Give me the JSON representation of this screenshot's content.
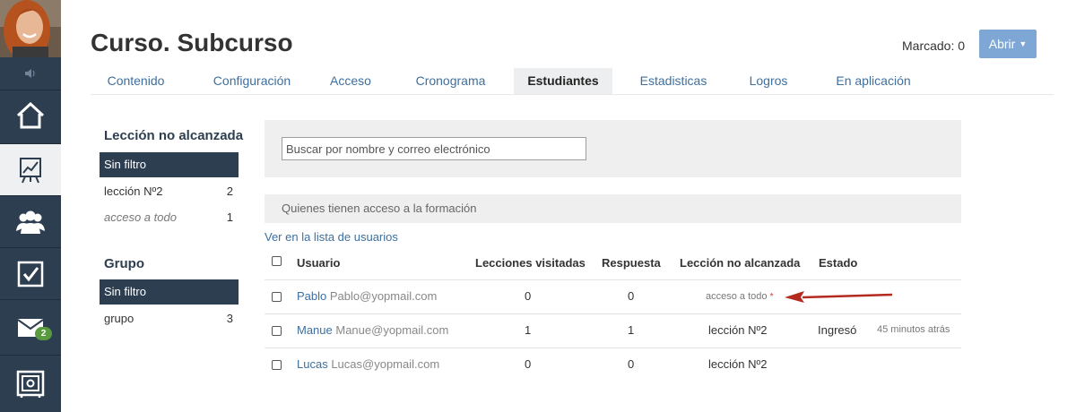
{
  "sidebar": {
    "mail_badge": "2"
  },
  "header": {
    "title": "Curso. Subcurso",
    "marcado": "Marcado: 0",
    "open_button": "Abrir"
  },
  "tabs": [
    "Contenido",
    "Configuración",
    "Acceso",
    "Cronograma",
    "Estudiantes",
    "Estadisticas",
    "Logros",
    "En aplicación"
  ],
  "filters": {
    "lesson": {
      "title": "Lección no alcanzada",
      "active": "Sin filtro",
      "items": [
        {
          "label": "lección Nº2",
          "count": "2"
        },
        {
          "label": "acceso a todo",
          "count": "1"
        }
      ]
    },
    "group": {
      "title": "Grupo",
      "active": "Sin filtro",
      "items": [
        {
          "label": "grupo",
          "count": "3"
        }
      ]
    }
  },
  "search": {
    "placeholder": "Buscar por nombre y correo electrónico"
  },
  "access_bar": "Quienes tienen acceso a la formación",
  "view_list_link": "Ver en la lista de usuarios",
  "table": {
    "headers": {
      "user": "Usuario",
      "lessons": "Lecciones visitadas",
      "answer": "Respuesta",
      "lesson_not_reached": "Lección no alcanzada",
      "status": "Estado"
    },
    "rows": [
      {
        "name": "Pablo",
        "email": "Pablo@yopmail.com",
        "lessons": "0",
        "answer": "0",
        "lesson": "acceso a todo",
        "star": "*",
        "status": "",
        "time": ""
      },
      {
        "name": "Manue",
        "email": "Manue@yopmail.com",
        "lessons": "1",
        "answer": "1",
        "lesson": "lección Nº2",
        "star": "",
        "status": "Ingresó",
        "time": "45 minutos atrás"
      },
      {
        "name": "Lucas",
        "email": "Lucas@yopmail.com",
        "lessons": "0",
        "answer": "0",
        "lesson": "lección Nº2",
        "star": "",
        "status": "",
        "time": ""
      }
    ]
  },
  "colors": {
    "sidebar": "#2d3e50",
    "link": "#3d6f9f",
    "open_button": "#7ea7d5",
    "arrow": "#b52a1f"
  }
}
